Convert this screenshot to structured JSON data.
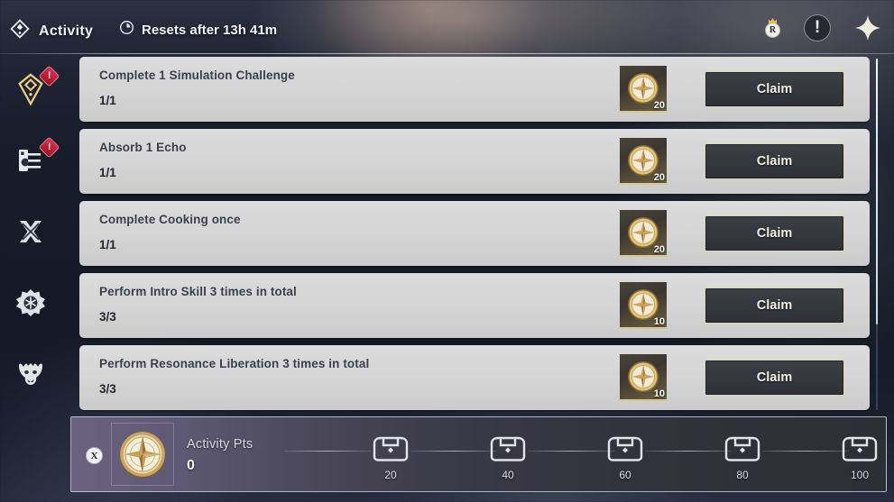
{
  "header": {
    "title": "Activity",
    "title_icon": "activity-diamond-icon",
    "reset_icon": "clock-icon",
    "reset_text": "Resets after 13h 41m",
    "icons": {
      "rank_badge_letter": "R",
      "rank_badge_name": "crowned-r-badge-icon",
      "info_label": "!",
      "info_name": "exclamation-icon",
      "close_name": "close-star-icon"
    }
  },
  "sidebar": {
    "items": [
      {
        "name": "sidebar-item-activity",
        "icon": "gold-diamond-icon",
        "selected": true,
        "badge": "!"
      },
      {
        "name": "sidebar-item-missions",
        "icon": "scroll-board-icon",
        "selected": false,
        "badge": "!"
      },
      {
        "name": "sidebar-item-combat",
        "icon": "crossed-blades-icon",
        "selected": false,
        "badge": ""
      },
      {
        "name": "sidebar-item-events",
        "icon": "gear-snowflake-icon",
        "selected": false,
        "badge": ""
      },
      {
        "name": "sidebar-item-bestiary",
        "icon": "dragon-head-icon",
        "selected": false,
        "badge": ""
      }
    ]
  },
  "tasks": [
    {
      "title": "Complete 1 Simulation Challenge",
      "progress": "1/1",
      "reward_count": "20",
      "reward_icon": "compass-medal-icon",
      "button": "Claim"
    },
    {
      "title": "Absorb 1 Echo",
      "progress": "1/1",
      "reward_count": "20",
      "reward_icon": "compass-medal-icon",
      "button": "Claim"
    },
    {
      "title": "Complete Cooking once",
      "progress": "1/1",
      "reward_count": "20",
      "reward_icon": "compass-medal-icon",
      "button": "Claim"
    },
    {
      "title": "Perform Intro Skill 3 times in total",
      "progress": "3/3",
      "reward_count": "10",
      "reward_icon": "compass-medal-icon",
      "button": "Claim"
    },
    {
      "title": "Perform Resonance Liberation 3 times in total",
      "progress": "3/3",
      "reward_count": "10",
      "reward_icon": "compass-medal-icon",
      "button": "Claim"
    }
  ],
  "progress_panel": {
    "close_badge": "X",
    "medal_icon": "compass-medal-icon",
    "label": "Activity Pts",
    "value": "0",
    "milestones": [
      {
        "value": "20",
        "icon": "chest-icon"
      },
      {
        "value": "40",
        "icon": "chest-icon"
      },
      {
        "value": "60",
        "icon": "chest-icon"
      },
      {
        "value": "80",
        "icon": "chest-icon"
      },
      {
        "value": "100",
        "icon": "chest-icon"
      }
    ]
  },
  "colors": {
    "accent_gold": "#e3d9a8",
    "row_bg": "#d6d6d6",
    "badge_red": "#d6283f",
    "panel_dark": "#2e3138"
  }
}
